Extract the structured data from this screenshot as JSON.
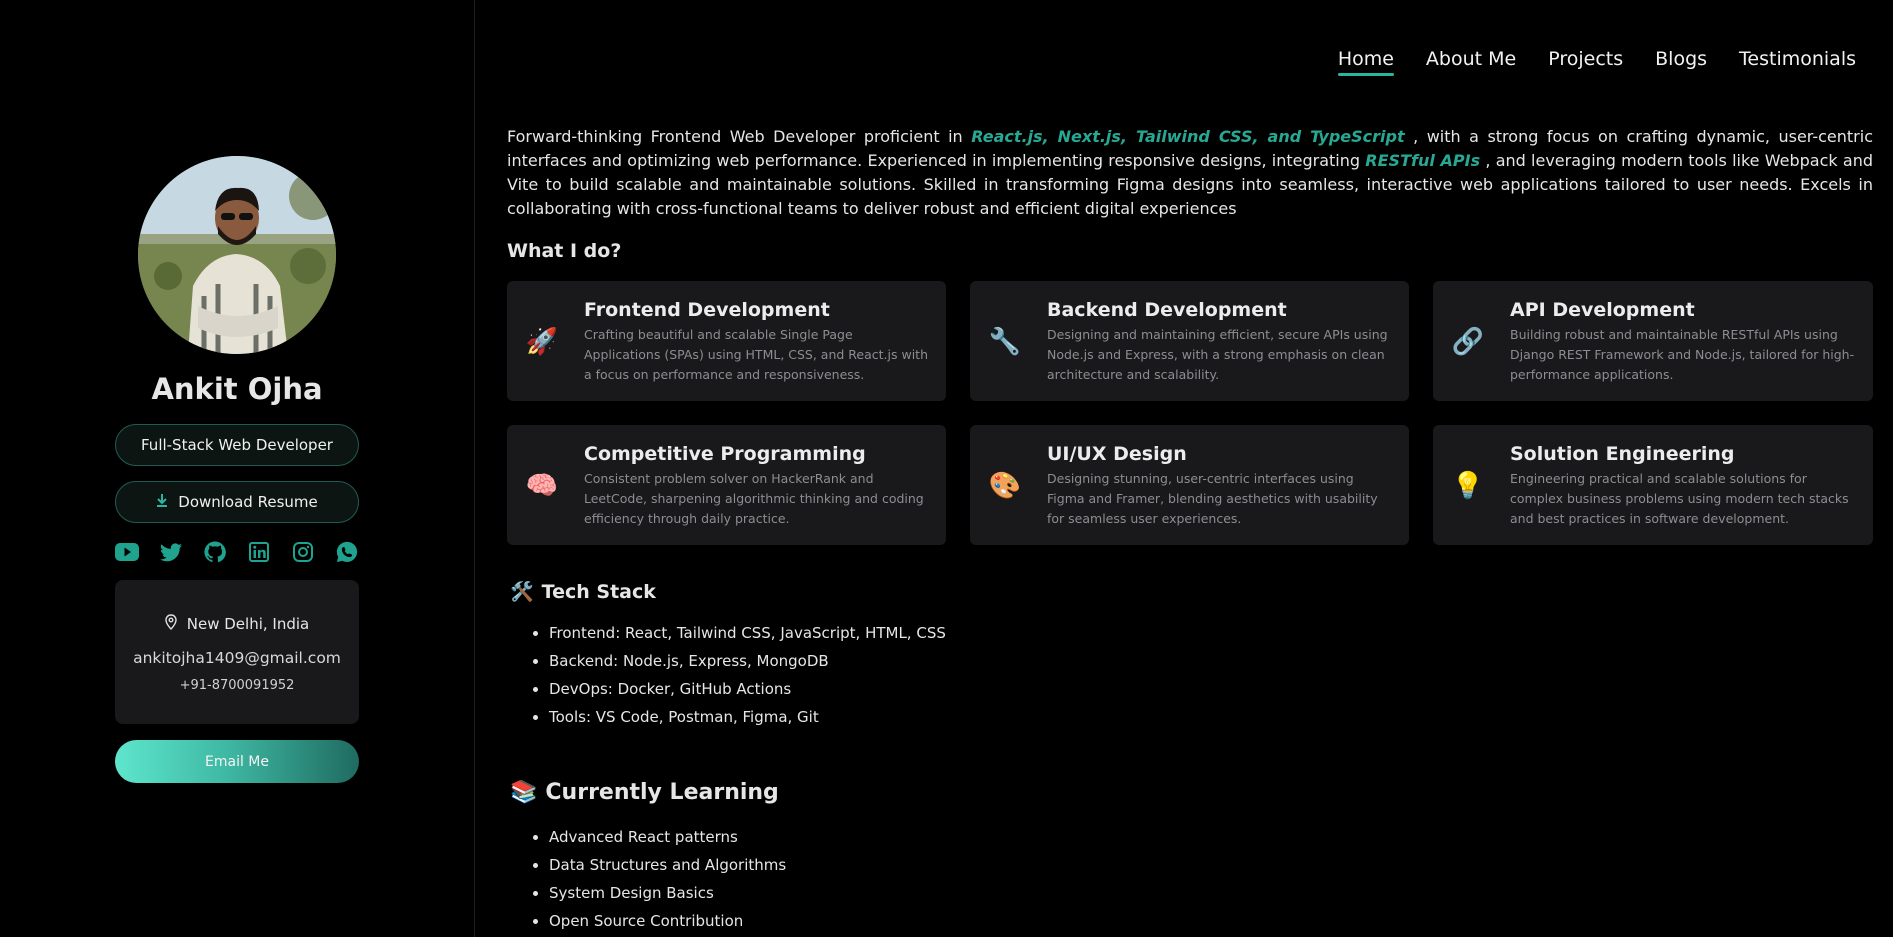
{
  "profile": {
    "name": "Ankit Ojha",
    "role": "Full-Stack Web Developer",
    "resume_label": "Download Resume",
    "socials": [
      "youtube-icon",
      "twitter-icon",
      "github-icon",
      "linkedin-icon",
      "instagram-icon",
      "whatsapp-icon"
    ],
    "location": "New Delhi, India",
    "email": "ankitojha1409@gmail.com",
    "phone": "+91-8700091952",
    "email_button": "Email Me"
  },
  "nav": {
    "home": "Home",
    "about": "About Me",
    "projects": "Projects",
    "blogs": "Blogs",
    "testimonials": "Testimonials"
  },
  "intro": {
    "part1": "Forward-thinking Frontend Web Developer proficient in ",
    "highlight1": "React.js, Next.js, Tailwind CSS, and TypeScript",
    "part2": " , with a strong focus on crafting dynamic, user-centric interfaces and optimizing web performance. Experienced in implementing responsive designs, integrating ",
    "highlight2": "RESTful APIs",
    "part3": " , and leveraging modern tools like Webpack and Vite to build scalable and maintainable solutions. Skilled in transforming Figma designs into seamless, interactive web applications tailored to user needs. Excels in collaborating with cross-functional teams to deliver robust and efficient digital experiences"
  },
  "what_i_do": {
    "heading": "What I do?",
    "services": [
      {
        "icon": "🚀",
        "title": "Frontend Development",
        "desc": "Crafting beautiful and scalable Single Page Applications (SPAs) using HTML, CSS, and React.js with a focus on performance and responsiveness."
      },
      {
        "icon": "🔧",
        "title": "Backend Development",
        "desc": "Designing and maintaining efficient, secure APIs using Node.js and Express, with a strong emphasis on clean architecture and scalability."
      },
      {
        "icon": "🔗",
        "title": "API Development",
        "desc": "Building robust and maintainable RESTful APIs using Django REST Framework and Node.js, tailored for high-performance applications."
      },
      {
        "icon": "🧠",
        "title": "Competitive Programming",
        "desc": "Consistent problem solver on HackerRank and LeetCode, sharpening algorithmic thinking and coding efficiency through daily practice."
      },
      {
        "icon": "🎨",
        "title": "UI/UX Design",
        "desc": "Designing stunning, user-centric interfaces using Figma and Framer, blending aesthetics with usability for seamless user experiences."
      },
      {
        "icon": "💡",
        "title": "Solution Engineering",
        "desc": "Engineering practical and scalable solutions for complex business problems using modern tech stacks and best practices in software development."
      }
    ]
  },
  "tech_stack": {
    "icon": "🛠️",
    "heading": "Tech Stack",
    "items": [
      "Frontend: React, Tailwind CSS, JavaScript, HTML, CSS",
      "Backend: Node.js, Express, MongoDB",
      "DevOps: Docker, GitHub Actions",
      "Tools: VS Code, Postman, Figma, Git"
    ]
  },
  "learning": {
    "icon": "📚",
    "heading": "Currently Learning",
    "items": [
      "Advanced React patterns",
      "Data Structures and Algorithms",
      "System Design Basics",
      "Open Source Contribution"
    ]
  },
  "colors": {
    "accent": "#28a893",
    "card_bg": "#19191b",
    "page_bg": "#000000"
  }
}
